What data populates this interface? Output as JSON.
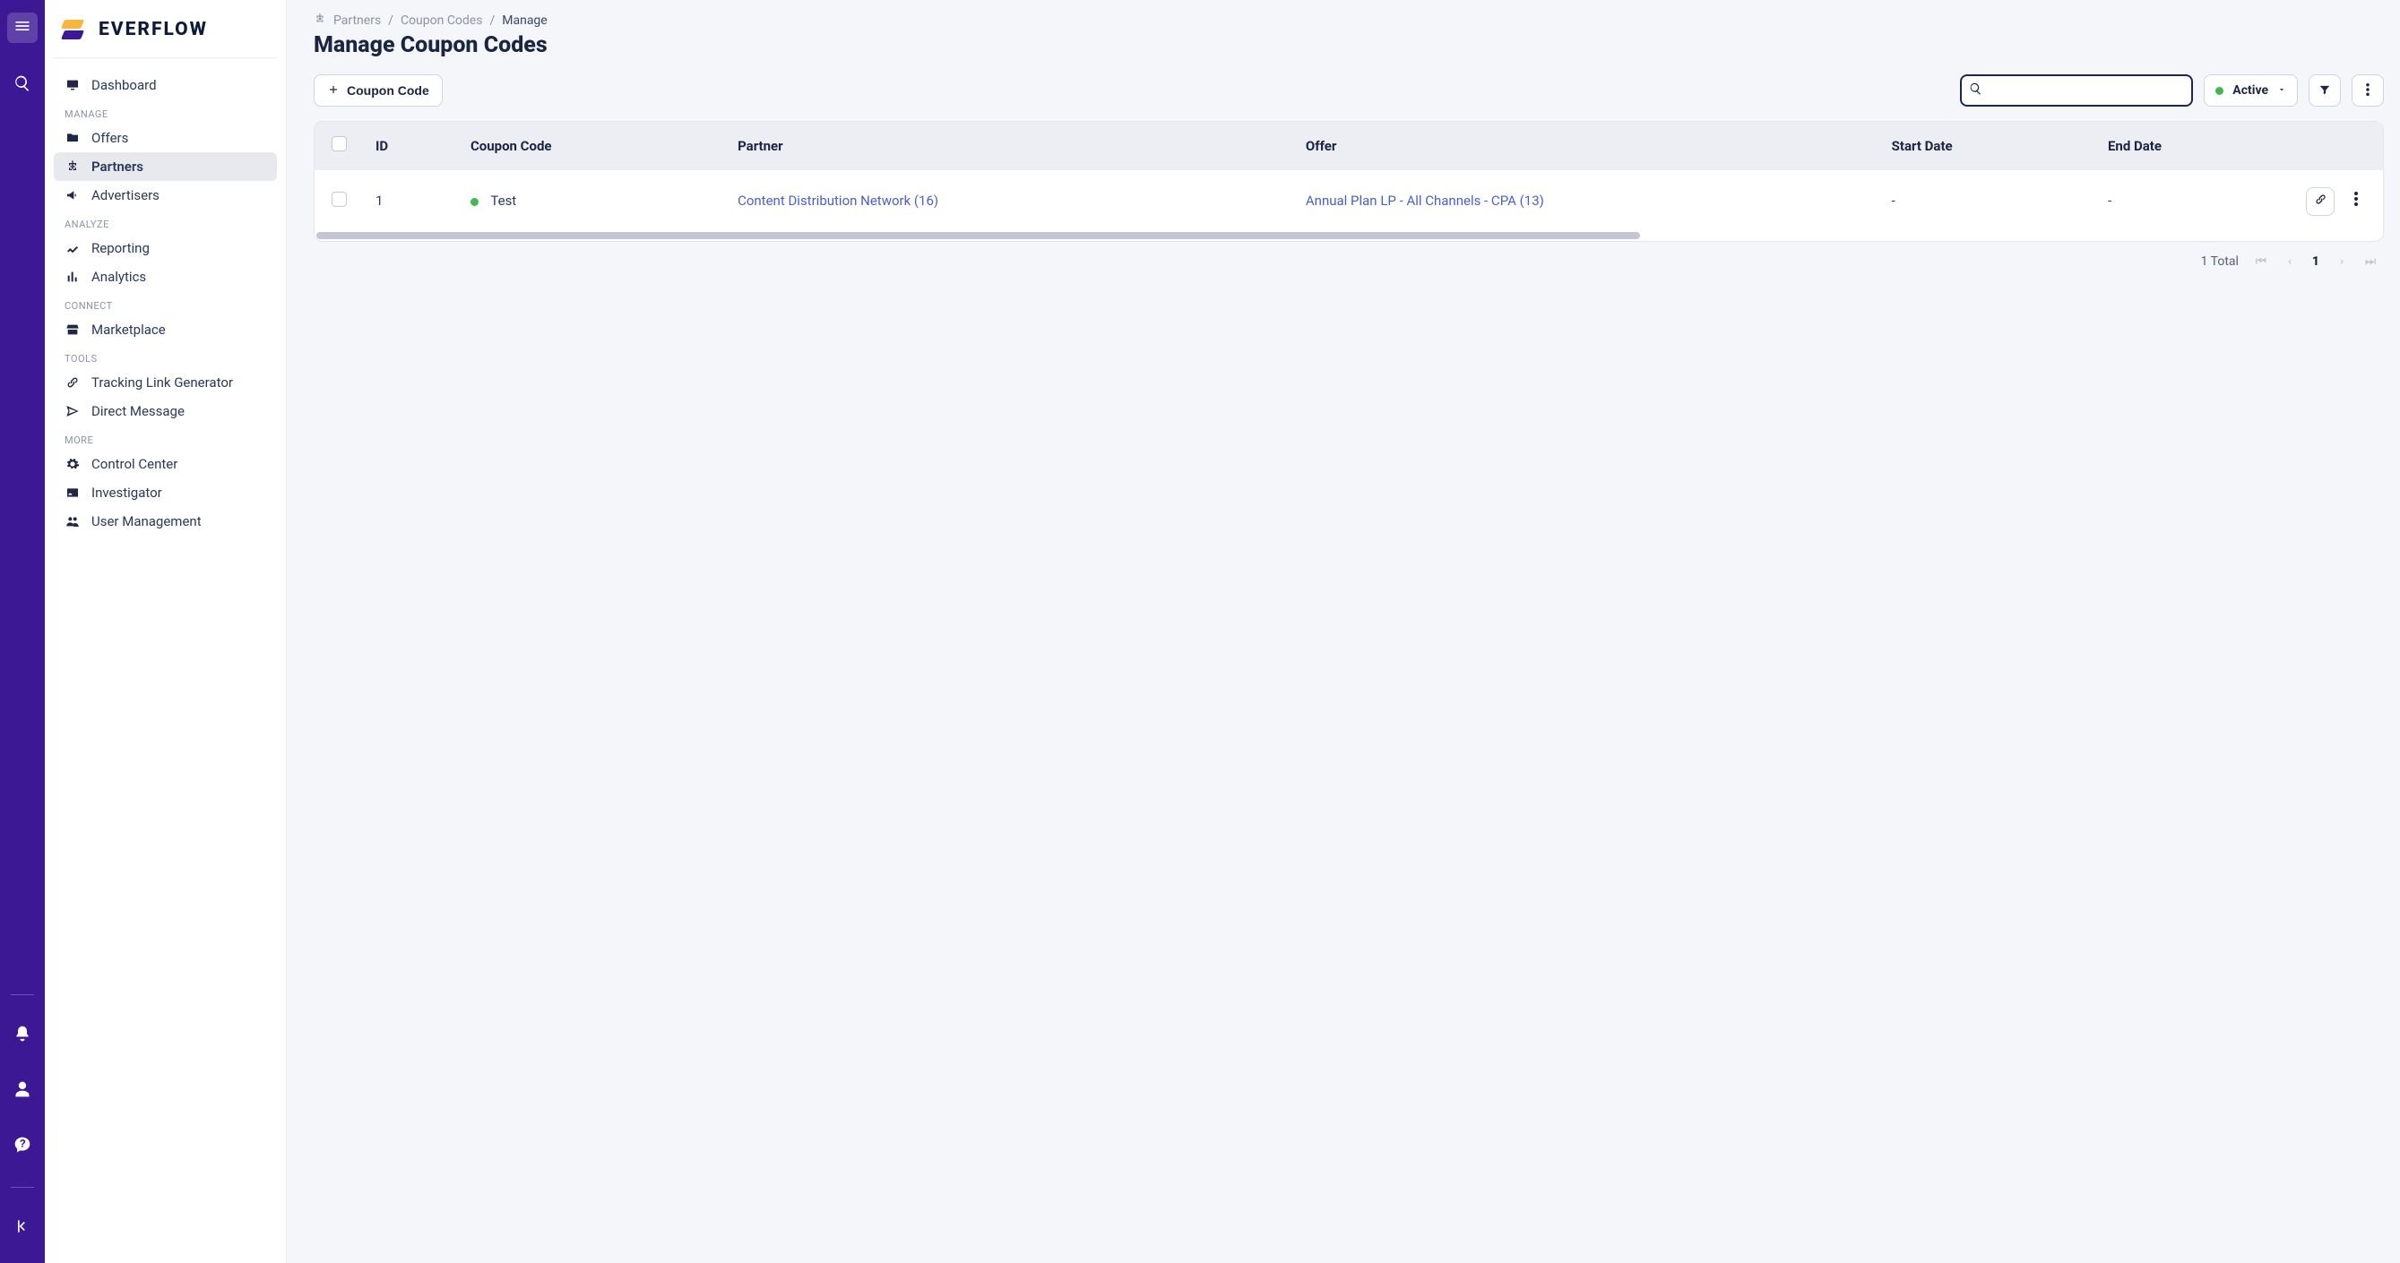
{
  "brand": {
    "name": "EVERFLOW"
  },
  "sidebar": {
    "top_item": {
      "label": "Dashboard",
      "icon": "desktop-icon"
    },
    "sections": [
      {
        "title": "MANAGE",
        "items": [
          {
            "label": "Offers",
            "icon": "folder-icon",
            "active": false
          },
          {
            "label": "Partners",
            "icon": "sitemap-icon",
            "active": true
          },
          {
            "label": "Advertisers",
            "icon": "megaphone-icon",
            "active": false
          }
        ]
      },
      {
        "title": "ANALYZE",
        "items": [
          {
            "label": "Reporting",
            "icon": "chart-icon",
            "active": false
          },
          {
            "label": "Analytics",
            "icon": "bars-icon",
            "active": false
          }
        ]
      },
      {
        "title": "CONNECT",
        "items": [
          {
            "label": "Marketplace",
            "icon": "store-icon",
            "active": false
          }
        ]
      },
      {
        "title": "TOOLS",
        "items": [
          {
            "label": "Tracking Link Generator",
            "icon": "link-icon",
            "active": false
          },
          {
            "label": "Direct Message",
            "icon": "send-icon",
            "active": false
          }
        ]
      },
      {
        "title": "MORE",
        "items": [
          {
            "label": "Control Center",
            "icon": "gear-icon",
            "active": false
          },
          {
            "label": "Investigator",
            "icon": "id-icon",
            "active": false
          },
          {
            "label": "User Management",
            "icon": "users-icon",
            "active": false
          }
        ]
      }
    ]
  },
  "breadcrumb": {
    "items": [
      "Partners",
      "Coupon Codes",
      "Manage"
    ]
  },
  "page": {
    "title": "Manage Coupon Codes"
  },
  "toolbar": {
    "add_button": "Coupon Code",
    "status_filter": "Active",
    "search_value": ""
  },
  "table": {
    "columns": [
      "ID",
      "Coupon Code",
      "Partner",
      "Offer",
      "Start Date",
      "End Date"
    ],
    "rows": [
      {
        "id": "1",
        "coupon_code": "Test",
        "coupon_status": "active",
        "partner": "Content Distribution Network (16)",
        "offer": "Annual Plan LP - All Channels - CPA (13)",
        "start_date": "-",
        "end_date": "-"
      }
    ]
  },
  "pagination": {
    "total_label": "1 Total",
    "current_page": "1"
  }
}
